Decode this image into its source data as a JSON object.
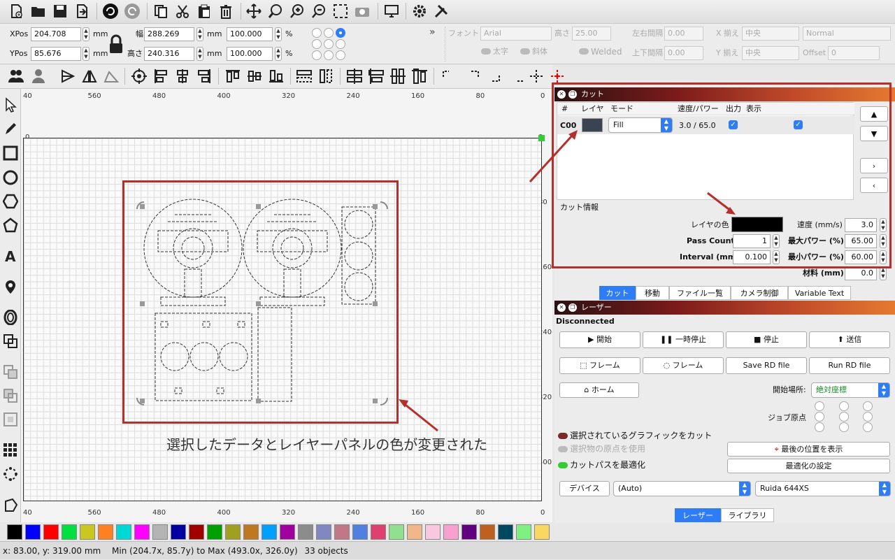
{
  "toolbar2": {
    "xpos_label": "XPos",
    "xpos_value": "204.708",
    "ypos_label": "YPos",
    "ypos_value": "85.676",
    "unit_mm": "mm",
    "width_label": "幅",
    "width_value": "288.269",
    "height_label": "高さ",
    "height_value": "240.316",
    "scale_w": "100.000",
    "scale_h": "100.000",
    "percent": "%",
    "more": "»",
    "font_label": "フォント",
    "font_value": "Arial",
    "fheight_label": "高さ",
    "fheight_value": "25.00",
    "hspace_label": "左右間隔",
    "hspace_value": "0.00",
    "vspace_label": "上下間隔",
    "vspace_value": "0.00",
    "xalign_label": "X 揃え",
    "xalign_value": "中央",
    "yalign_label": "Y 揃え",
    "yalign_value": "中央",
    "style_value": "Normal",
    "offset_label": "Offset",
    "offset_value": "0",
    "bold_label": "太字",
    "italic_label": "斜体",
    "welded_label": "Welded"
  },
  "rulers": {
    "top": [
      "40",
      "560",
      "480",
      "400",
      "320",
      "240",
      "160",
      "80",
      "0"
    ],
    "bottom": [
      "40",
      "560",
      "480",
      "400",
      "320",
      "240",
      "160",
      "80",
      "0"
    ],
    "left": [
      "0",
      "80",
      "160",
      "240",
      "320",
      "400"
    ],
    "right": [
      "0",
      "80",
      "160",
      "240",
      "320",
      "400"
    ]
  },
  "annotation": "選択したデータとレイヤーパネルの色が変更された",
  "cut_panel": {
    "title": "カット",
    "headers": [
      "#",
      "レイヤ",
      "モード",
      "速度/パワー",
      "出力",
      "表示"
    ],
    "row": {
      "num": "C00",
      "color": "#3a4450",
      "mode": "Fill",
      "speed_power": "3.0 / 65.0"
    },
    "info_label": "カット情報",
    "layer_color_label": "レイヤの色",
    "layer_color": "#000000",
    "speed_label": "速度 (mm/s)",
    "speed_value": "3.0",
    "pass_label": "Pass Count",
    "pass_value": "1",
    "maxp_label": "最大パワー (%)",
    "maxp_value": "65.00",
    "interval_label": "Interval (mm)",
    "interval_value": "0.100",
    "minp_label": "最小パワー (%)",
    "minp_value": "60.00",
    "material_label": "材料 (mm)",
    "material_value": "0.0"
  },
  "panel_tabs": [
    "カット",
    "移動",
    "ファイル一覧",
    "カメラ制御",
    "Variable Text"
  ],
  "laser_panel": {
    "title": "レーザー",
    "status": "Disconnected",
    "start": "開始",
    "pause": "一時停止",
    "stop": "停止",
    "send": "送信",
    "frame1": "フレーム",
    "frame2": "フレーム",
    "save_rd": "Save RD file",
    "run_rd": "Run RD file",
    "home": "ホーム",
    "start_from_label": "開始場所:",
    "start_from_value": "絶対座標",
    "job_origin_label": "ジョブ原点",
    "cut_selected": "選択されているグラフィックをカット",
    "use_origin": "選択物の原点を使用",
    "optimize": "カットパスを最適化",
    "show_last": "最後の位置を表示",
    "opt_settings": "最適化の設定",
    "devices": "デバイス",
    "port_value": "(Auto)",
    "device_value": "Ruida 644XS"
  },
  "bottom_tabs": [
    "レーザー",
    "ライブラリ"
  ],
  "palette": [
    "#000000",
    "#0000ff",
    "#ff0000",
    "#00e040",
    "#c8c820",
    "#ff8020",
    "#00d8d8",
    "#ff00ff",
    "#b4b4b4",
    "#0000a0",
    "#a00000",
    "#00a000",
    "#a0a020",
    "#c07820",
    "#00a0ff",
    "#a000a0",
    "#8c8c8c",
    "#8088c0",
    "#c07888",
    "#5080e0",
    "#e04070",
    "#90e090",
    "#f0b888",
    "#f8c8e0",
    "#f8a0d0",
    "#600080",
    "#c06020",
    "#004860",
    "#80f080",
    "#f8d860"
  ],
  "status": {
    "coords": "x: 83.00, y: 319.00 mm",
    "bounds": "Min (204.7x, 85.7y) to Max (493.0x, 326.0y)",
    "count": "33 objects"
  }
}
